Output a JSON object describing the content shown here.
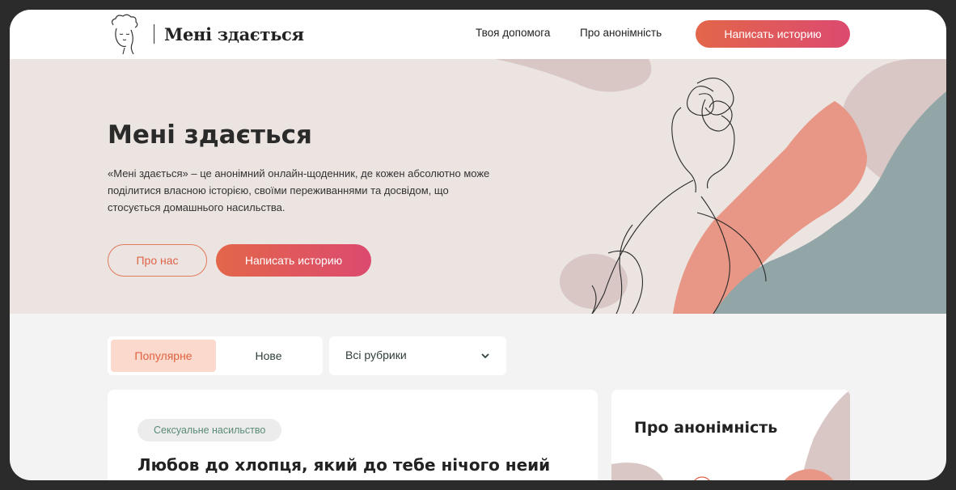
{
  "header": {
    "logo_text": "Мені здається",
    "nav": [
      "Твоя допомога",
      "Про анонімність"
    ],
    "cta_label": "Написать историю"
  },
  "hero": {
    "title": "Мені здається",
    "description": "«Мені здається» – це анонімний онлайн-щоденник, де кожен абсолютно може поділитися власною історією, своїми переживаннями та досвідом, що стосується домашнього насильства.",
    "about_label": "Про нас",
    "write_label": "Написать историю"
  },
  "filters": {
    "tabs": [
      {
        "label": "Популярне",
        "active": true
      },
      {
        "label": "Нове",
        "active": false
      }
    ],
    "rubric_select": "Всі рубрики"
  },
  "story": {
    "tag": "Сексуальне насильство",
    "title": "Любов до хлопця, який до тебе нічого неий до"
  },
  "sidebar": {
    "title": "Про анонімність"
  },
  "colors": {
    "accent_orange": "#e3664a",
    "accent_pink": "#dc4a6f",
    "hero_bg": "#ebe4e1",
    "salmon": "#e89685",
    "teal_grey": "#92a5a7",
    "dusty_pink": "#d8c7c4"
  },
  "icons": [
    "logo-face-icon",
    "chevron-down-icon"
  ]
}
